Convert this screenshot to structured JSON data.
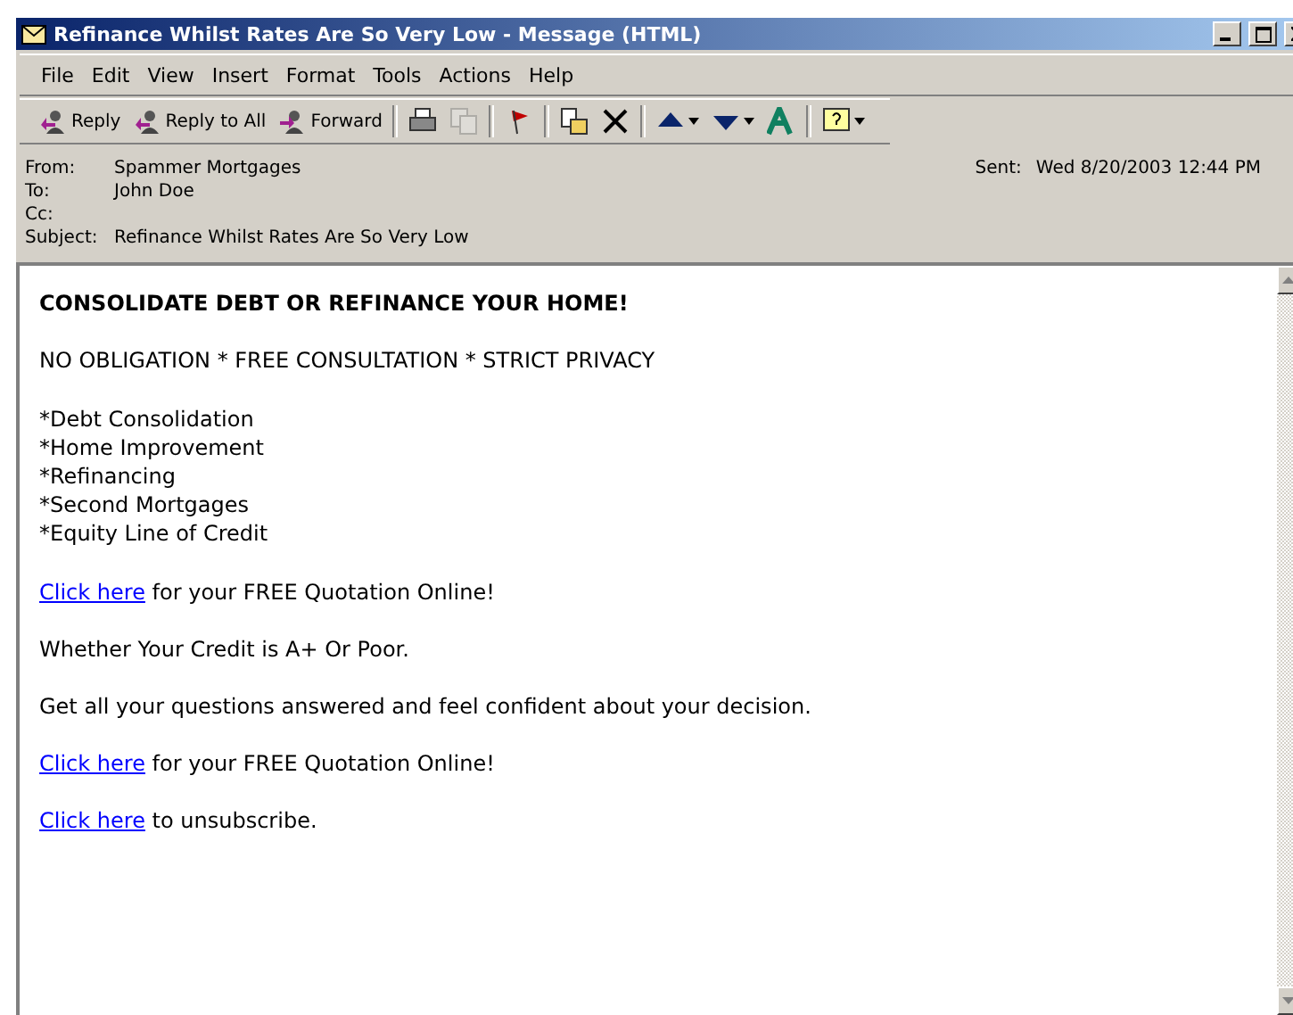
{
  "window": {
    "title": "Refinance Whilst Rates Are So Very Low - Message (HTML)"
  },
  "menu": [
    "File",
    "Edit",
    "View",
    "Insert",
    "Format",
    "Tools",
    "Actions",
    "Help"
  ],
  "toolbar": [
    {
      "kind": "text",
      "label": "Reply"
    },
    {
      "kind": "text",
      "label": "Reply to All"
    },
    {
      "kind": "text",
      "label": "Forward"
    },
    {
      "kind": "sep"
    },
    {
      "kind": "icon",
      "disabled": false
    },
    {
      "kind": "icon",
      "disabled": true
    },
    {
      "kind": "sep"
    },
    {
      "kind": "icon",
      "disabled": false
    },
    {
      "kind": "sep"
    },
    {
      "kind": "icon",
      "disabled": false
    },
    {
      "kind": "icon",
      "disabled": false
    },
    {
      "kind": "sep"
    },
    {
      "kind": "drop",
      "disabled": false
    },
    {
      "kind": "drop",
      "disabled": false
    },
    {
      "kind": "icon",
      "disabled": false
    },
    {
      "kind": "sep"
    },
    {
      "kind": "drop",
      "disabled": false
    }
  ],
  "header": {
    "from_label": "From:",
    "from": "Spammer Mortgages",
    "sent_label": "Sent:",
    "sent": "Wed 8/20/2003 12:44 PM",
    "to_label": "To:",
    "to": "John Doe",
    "cc_label": "Cc:",
    "subject_label": "Subject:",
    "subject": "Refinance Whilst Rates Are So Very Low"
  },
  "body": [
    {
      "kind": "heading",
      "text": "CONSOLIDATE DEBT OR REFINANCE YOUR HOME!"
    },
    {
      "kind": "text",
      "text": "NO OBLIGATION * FREE CONSULTATION * STRICT PRIVACY"
    },
    {
      "kind": "list",
      "items": [
        "*Debt Consolidation",
        "*Home Improvement",
        "*Refinancing",
        "*Second Mortgages",
        "*Equity Line of Credit"
      ]
    },
    {
      "kind": "link",
      "link": "Click here",
      "text": "for your FREE Quotation Online!"
    },
    {
      "kind": "text",
      "text": "Whether Your Credit is A+ Or Poor."
    },
    {
      "kind": "text",
      "text": "Get all your questions answered and feel confident about your decision."
    },
    {
      "kind": "link",
      "link": "Click here",
      "text": "for your FREE Quotation Online!"
    },
    {
      "kind": "link",
      "link": "Click here",
      "text": "to unsubscribe."
    }
  ]
}
